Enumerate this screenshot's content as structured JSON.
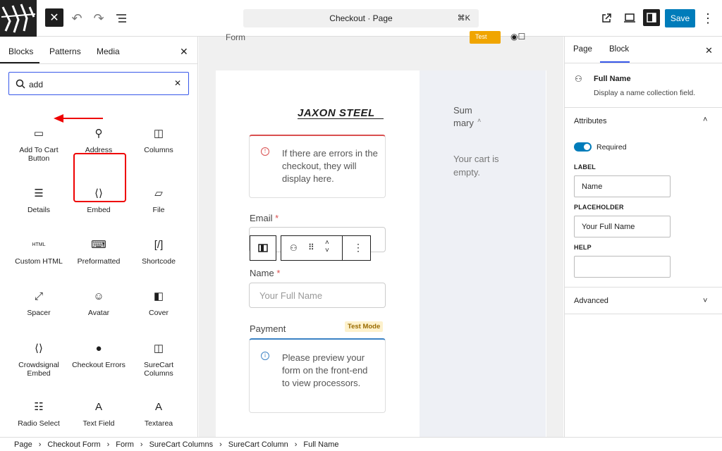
{
  "topbar": {
    "title": "Checkout · Page",
    "shortcut": "⌘K",
    "save_label": "Save",
    "close_glyph": "✕"
  },
  "inserter": {
    "tabs": [
      "Blocks",
      "Patterns",
      "Media"
    ],
    "search_value": "add",
    "blocks": [
      {
        "label": "Add To Cart Button",
        "icon": "button-icon"
      },
      {
        "label": "Address",
        "icon": "pin-icon"
      },
      {
        "label": "Columns",
        "icon": "columns-icon"
      },
      {
        "label": "Details",
        "icon": "details-icon"
      },
      {
        "label": "Embed",
        "icon": "embed-icon"
      },
      {
        "label": "File",
        "icon": "folder-icon"
      },
      {
        "label": "Custom HTML",
        "icon": "html-icon"
      },
      {
        "label": "Preformatted",
        "icon": "preformatted-icon"
      },
      {
        "label": "Shortcode",
        "icon": "shortcode-icon"
      },
      {
        "label": "Spacer",
        "icon": "spacer-icon"
      },
      {
        "label": "Avatar",
        "icon": "avatar-icon"
      },
      {
        "label": "Cover",
        "icon": "cover-icon"
      },
      {
        "label": "Crowdsignal Embed",
        "icon": "embed-icon"
      },
      {
        "label": "Checkout Errors",
        "icon": "error-icon"
      },
      {
        "label": "SureCart Columns",
        "icon": "columns-icon"
      },
      {
        "label": "Radio Select",
        "icon": "radio-select-icon"
      },
      {
        "label": "Text Field",
        "icon": "text-field-icon"
      },
      {
        "label": "Textarea",
        "icon": "textarea-icon"
      }
    ]
  },
  "canvas": {
    "form_label": "Form",
    "test_badge": "Test",
    "logo_text": "JAXON STEEL",
    "error_text": "If there are errors in the checkout, they will display here.",
    "email_label": "Email",
    "name_label": "Name",
    "name_placeholder": "Your Full Name",
    "payment_label": "Payment",
    "test_mode": "Test Mode",
    "payment_text": "Please preview your form on the front-end to view processors.",
    "summary_title": "Summary",
    "cart_empty": "Your cart is empty.",
    "required_mark": "*"
  },
  "inspector": {
    "tabs": [
      "Page",
      "Block"
    ],
    "block_name": "Full Name",
    "block_desc": "Display a name collection field.",
    "attributes_label": "Attributes",
    "required_label": "Required",
    "required_on": true,
    "label_title": "LABEL",
    "label_value": "Name",
    "placeholder_title": "PLACEHOLDER",
    "placeholder_value": "Your Full Name",
    "help_title": "HELP",
    "help_value": "",
    "advanced_label": "Advanced"
  },
  "breadcrumb": [
    "Page",
    "Checkout Form",
    "Form",
    "SureCart Columns",
    "SureCart Column",
    "Full Name"
  ],
  "colors": {
    "accent": "#007cba",
    "highlight": "#e00000",
    "error": "#d94f4f",
    "test_badge": "#f0a500"
  }
}
